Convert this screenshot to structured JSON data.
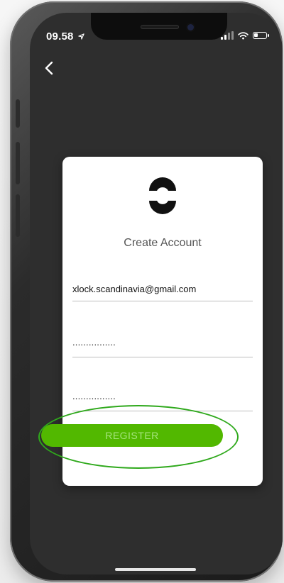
{
  "status_bar": {
    "time": "09.58",
    "icons": [
      "location-arrow-icon",
      "cellular-signal-icon",
      "wifi-icon",
      "battery-icon"
    ]
  },
  "nav": {
    "back_icon": "chevron-left-icon"
  },
  "card": {
    "logo_icon": "brand-logo-icon",
    "title": "Create Account",
    "email_value": "xlock.scandinavia@gmail.com",
    "password_masked": "................",
    "confirm_password_masked": "................",
    "register_label": "REGISTER"
  },
  "colors": {
    "screen_background": "#2e2e2e",
    "card_background": "#ffffff",
    "register_button": "#52b800",
    "register_label": "#a5e47d",
    "highlight_ring": "#2fa91c"
  }
}
